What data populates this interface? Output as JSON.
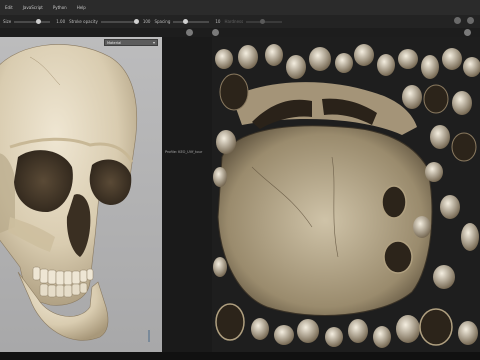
{
  "menubar": {
    "items": [
      "Edit",
      "JavaScript",
      "Python",
      "Help"
    ]
  },
  "toolbar": {
    "size_label": "Size",
    "size_value": "1.00",
    "opacity_label": "Stroke opacity",
    "opacity_value": "100",
    "spacing_label": "Spacing",
    "spacing_value": "10",
    "ring_label": "Hardness"
  },
  "viewport3d": {
    "material_dropdown": {
      "selected": "Material"
    }
  },
  "uv_viewport": {
    "profile_label": "Profile: KEO_UVf_tour"
  },
  "colors": {
    "viewport_bg": "#b3b3b4",
    "uv_bg": "#1e1e1e",
    "bone": "#e6dcc8"
  }
}
